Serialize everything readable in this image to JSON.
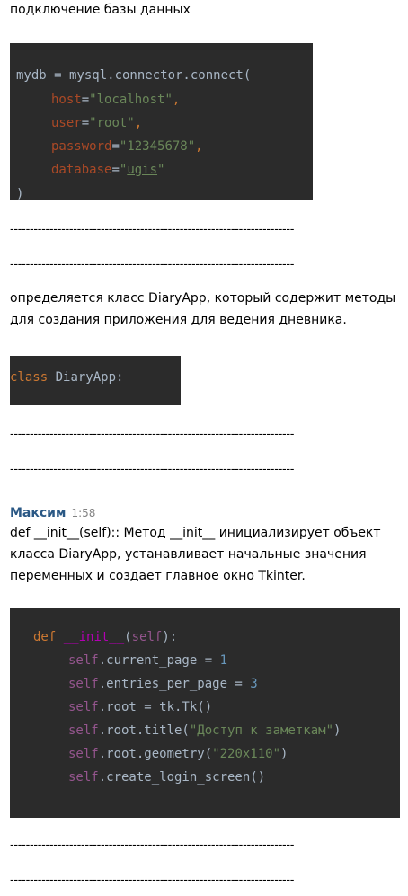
{
  "messages": {
    "db_heading": "подключение базы данных",
    "diary_line1": "определяется класс DiaryApp, который содержит методы",
    "diary_line2": "для создания приложения для ведения дневника.",
    "author": "Максим",
    "time": "1:58",
    "init_line1": "def __init__(self):: Метод __init__ инициализирует объект",
    "init_line2": "класса DiaryApp, устанавливает начальные значения",
    "init_line3": "переменных и создает главное окно Tkinter.",
    "separator": "------------------------------------------------------------------------"
  },
  "code_db": {
    "l1_a": "mydb = mysql.connector.connect(",
    "l2_key": "host",
    "l2_eq": "=",
    "l2_val": "\"localhost\"",
    "l2_end": ",",
    "l3_key": "user",
    "l3_eq": "=",
    "l3_val": "\"root\"",
    "l3_end": ",",
    "l4_key": "password",
    "l4_eq": "=",
    "l4_val": "\"12345678\"",
    "l4_end": ",",
    "l5_key": "database",
    "l5_eq": "=",
    "l5_q1": "\"",
    "l5_val": "ugis",
    "l5_q2": "\"",
    "l6": ")"
  },
  "code_class": {
    "kw": "class",
    "name": " DiaryApp:"
  },
  "code_init": {
    "l1_kw": "def",
    "l1_fn": " __init__",
    "l1_p": "(",
    "l1_self": "self",
    "l1_end": "):",
    "l2_self": "self",
    "l2_rest": ".current_page = ",
    "l2_num": "1",
    "l3_self": "self",
    "l3_rest": ".entries_per_page = ",
    "l3_num": "3",
    "l4_self": "self",
    "l4_rest": ".root = tk.Tk()",
    "l5_self": "self",
    "l5_rest": ".root.title(",
    "l5_str": "\"Доступ к заметкам\"",
    "l5_end": ")",
    "l6_self": "self",
    "l6_rest": ".root.geometry(",
    "l6_str": "\"220x110\"",
    "l6_end": ")",
    "l7_self": "self",
    "l7_rest": ".create_login_screen()"
  },
  "colors": {
    "code_bg": "#2b2b2b",
    "keyword": "#cc7832",
    "param": "#aa4926",
    "string": "#6a8759",
    "number": "#6897bb",
    "self": "#94558d",
    "author": "#2a5885"
  }
}
